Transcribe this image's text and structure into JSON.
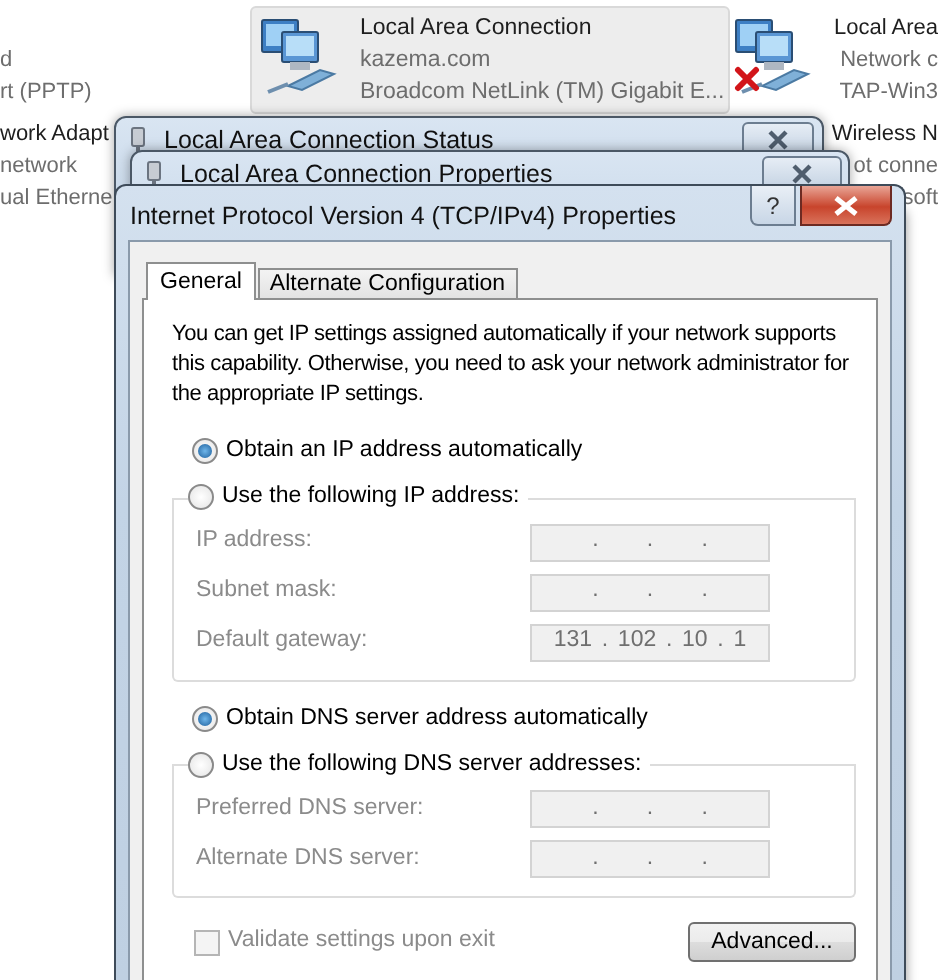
{
  "explorer": {
    "adapters": [
      {
        "kind": "cut",
        "lines": [
          "d",
          "rt (PPTP)"
        ],
        "selected": false
      },
      {
        "kind": "cut",
        "lines": [
          "work Adapt",
          "network",
          "ual Etherne"
        ],
        "selected": false
      },
      {
        "kind": "full",
        "lines": [
          "Local Area Connection",
          "kazema.com",
          "Broadcom NetLink (TM) Gigabit E..."
        ],
        "selected": true,
        "disconnected": false
      },
      {
        "kind": "full",
        "lines": [
          "Local Area",
          "Network c",
          "TAP-Win3"
        ],
        "selected": false,
        "disconnected": true
      },
      {
        "kind": "cut",
        "lines": [
          "Wireless N",
          "ot conne",
          "soft"
        ],
        "selected": false
      }
    ]
  },
  "windows": [
    {
      "title": "Local Area Connection Status"
    },
    {
      "title": "Local Area Connection Properties"
    }
  ],
  "dialog": {
    "title": "Internet Protocol Version 4 (TCP/IPv4) Properties",
    "help_button": "?",
    "tabs": [
      {
        "label": "General",
        "selected": true
      },
      {
        "label": "Alternate Configuration",
        "selected": false
      }
    ],
    "intro": "You can get IP settings assigned automatically if your network supports this capability. Otherwise, you need to ask your network administrator for the appropriate IP settings.",
    "sections": [
      {
        "auto": {
          "label": "Obtain an IP address automatically",
          "selected": true
        },
        "manual": {
          "label": "Use the following IP address:",
          "selected": false
        },
        "fields": [
          {
            "label": "IP address:",
            "parts": [
              ".",
              ".",
              "."
            ],
            "disabled": true
          },
          {
            "label": "Subnet mask:",
            "parts": [
              ".",
              ".",
              "."
            ],
            "disabled": true
          },
          {
            "label": "Default gateway:",
            "parts": [
              "131",
              ".",
              "102",
              ".",
              "10",
              ".",
              "1"
            ],
            "disabled": true
          }
        ]
      },
      {
        "auto": {
          "label": "Obtain DNS server address automatically",
          "selected": true
        },
        "manual": {
          "label": "Use the following DNS server addresses:",
          "selected": false
        },
        "fields": [
          {
            "label": "Preferred DNS server:",
            "parts": [
              ".",
              ".",
              "."
            ],
            "disabled": true
          },
          {
            "label": "Alternate DNS server:",
            "parts": [
              ".",
              ".",
              "."
            ],
            "disabled": true
          }
        ]
      }
    ],
    "validate": {
      "label": "Validate settings upon exit",
      "checked": false,
      "disabled": true
    },
    "buttons": [
      {
        "label": "Advanced..."
      }
    ]
  }
}
